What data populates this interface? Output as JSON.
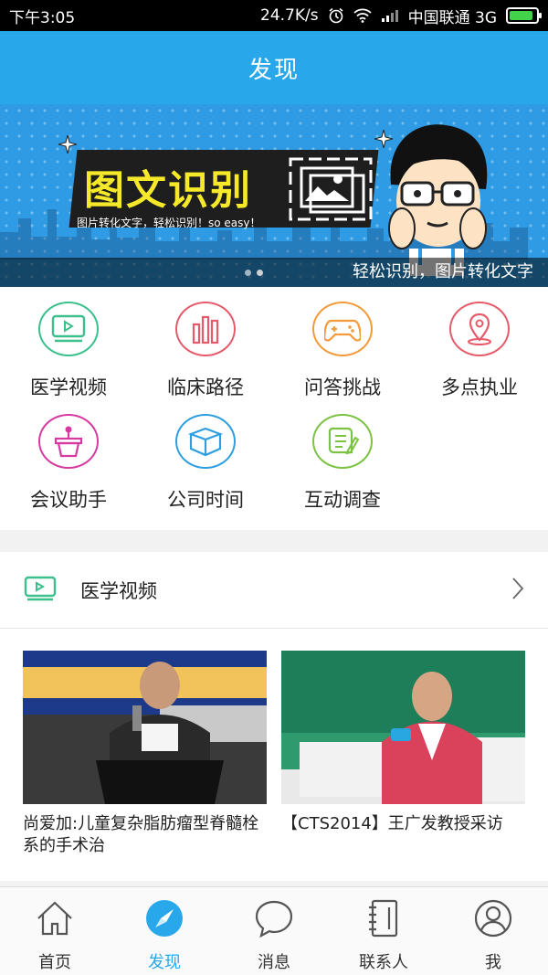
{
  "status_bar": {
    "time": "下午3:05",
    "speed": "24.7K/s",
    "carrier": "中国联通 3G",
    "battery_level": 0.9
  },
  "header": {
    "title": "发现"
  },
  "banner": {
    "headline": "图文识别",
    "subline": "图片转化文字，轻松识别！so easy！",
    "caption": "轻松识别，图片转化文字",
    "page_count": 2,
    "active_page": 1
  },
  "grid": {
    "items": [
      {
        "label": "医学视频",
        "icon": "video-icon",
        "color": "#3bbf8c"
      },
      {
        "label": "临床路径",
        "icon": "bars-icon",
        "color": "#e65a6a"
      },
      {
        "label": "问答挑战",
        "icon": "gamepad-icon",
        "color": "#f39a3a"
      },
      {
        "label": "多点执业",
        "icon": "location-icon",
        "color": "#e65a6a"
      },
      {
        "label": "会议助手",
        "icon": "podium-icon",
        "color": "#d63aa0"
      },
      {
        "label": "公司时间",
        "icon": "box-icon",
        "color": "#2d9fe0"
      },
      {
        "label": "互动调查",
        "icon": "survey-icon",
        "color": "#7cc243"
      }
    ]
  },
  "section": {
    "title": "医学视频",
    "videos": [
      {
        "title": "尚爱加:儿童复杂脂肪瘤型脊髓栓系的手术治"
      },
      {
        "title": "【CTS2014】王广发教授采访"
      }
    ]
  },
  "tabbar": {
    "tabs": [
      {
        "label": "首页",
        "icon": "home-icon"
      },
      {
        "label": "发现",
        "icon": "compass-icon",
        "active": true
      },
      {
        "label": "消息",
        "icon": "chat-bubble-icon"
      },
      {
        "label": "联系人",
        "icon": "contacts-book-icon"
      },
      {
        "label": "我",
        "icon": "user-icon"
      }
    ]
  },
  "colors": {
    "primary": "#28a7ea"
  }
}
